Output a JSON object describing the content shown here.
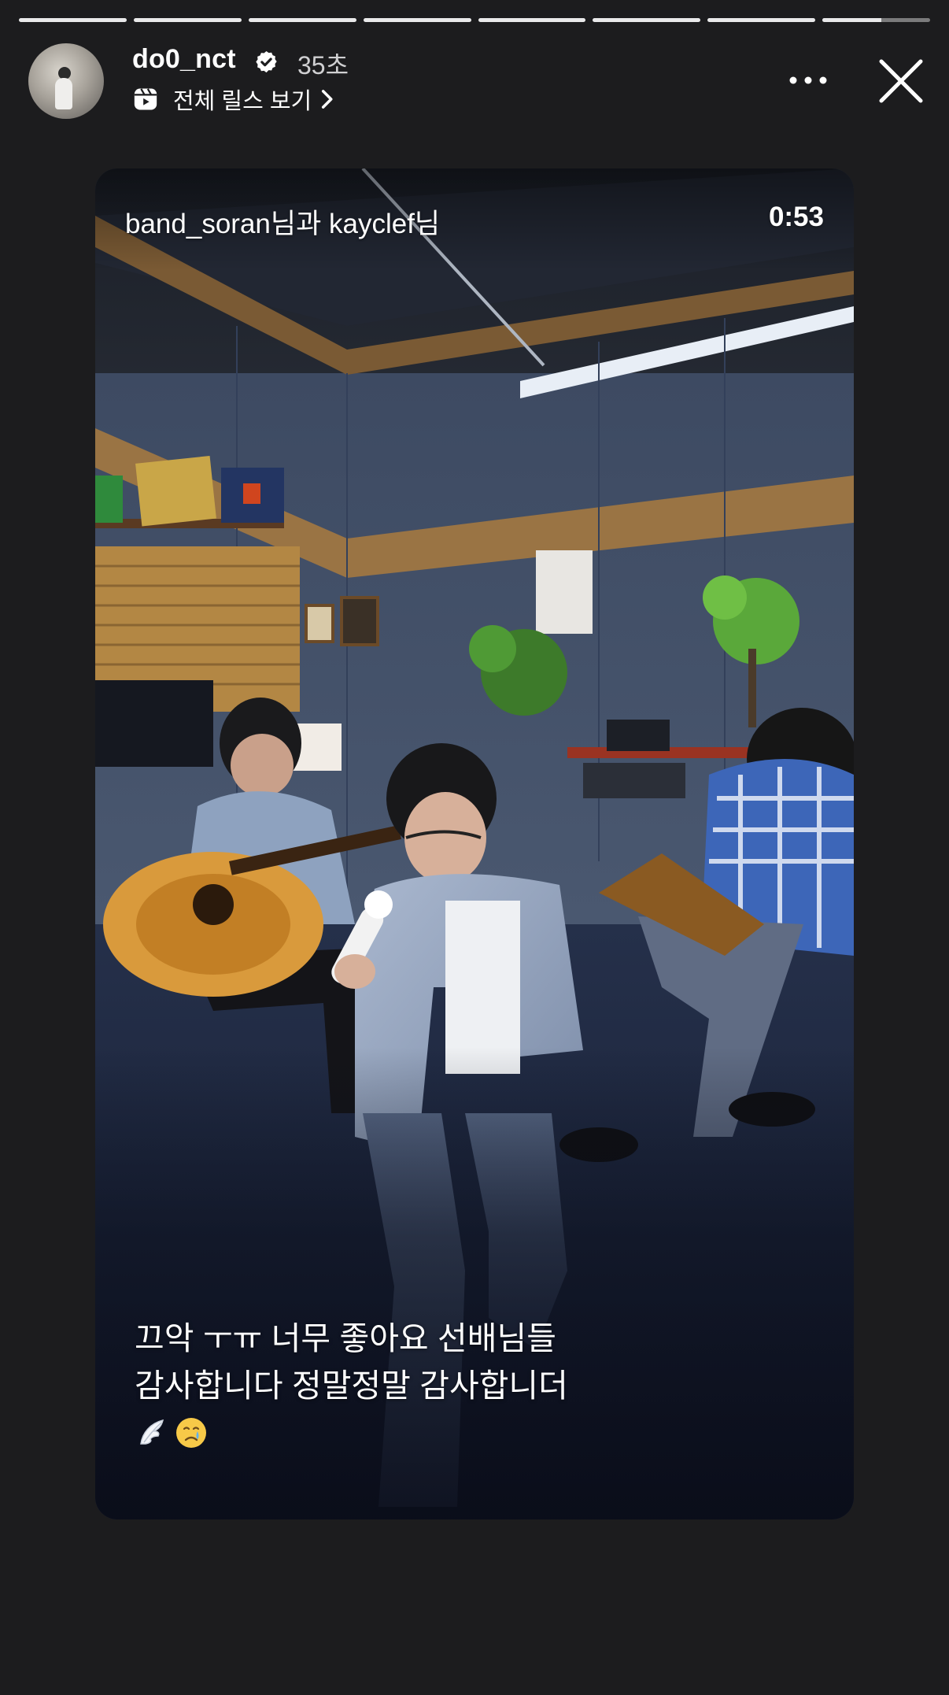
{
  "story": {
    "segment_count": 8,
    "segment_progress": [
      1,
      1,
      1,
      1,
      1,
      1,
      1,
      0.55
    ]
  },
  "header": {
    "username": "do0_nct",
    "verified": true,
    "time_ago": "35초",
    "reels_link_label": "전체 릴스 보기",
    "icons": [
      "reels-icon",
      "chevron-right-icon",
      "more-options-icon",
      "close-icon"
    ]
  },
  "media": {
    "collab_label": "band_soran님과 kayclef님",
    "duration": "0:53",
    "caption_lines": [
      "끄악 ㅜㅠ 너무 좋아요 선배님들",
      "감사합니다 정말정말 감사합니더"
    ],
    "caption_emojis": [
      "wing-emoji",
      "crying-face-emoji"
    ]
  },
  "colors": {
    "background": "#1c1c1e",
    "progress_active": "#e9e9ea",
    "progress_inactive": "#6b6b6d",
    "verified_badge": "#ffffff"
  }
}
